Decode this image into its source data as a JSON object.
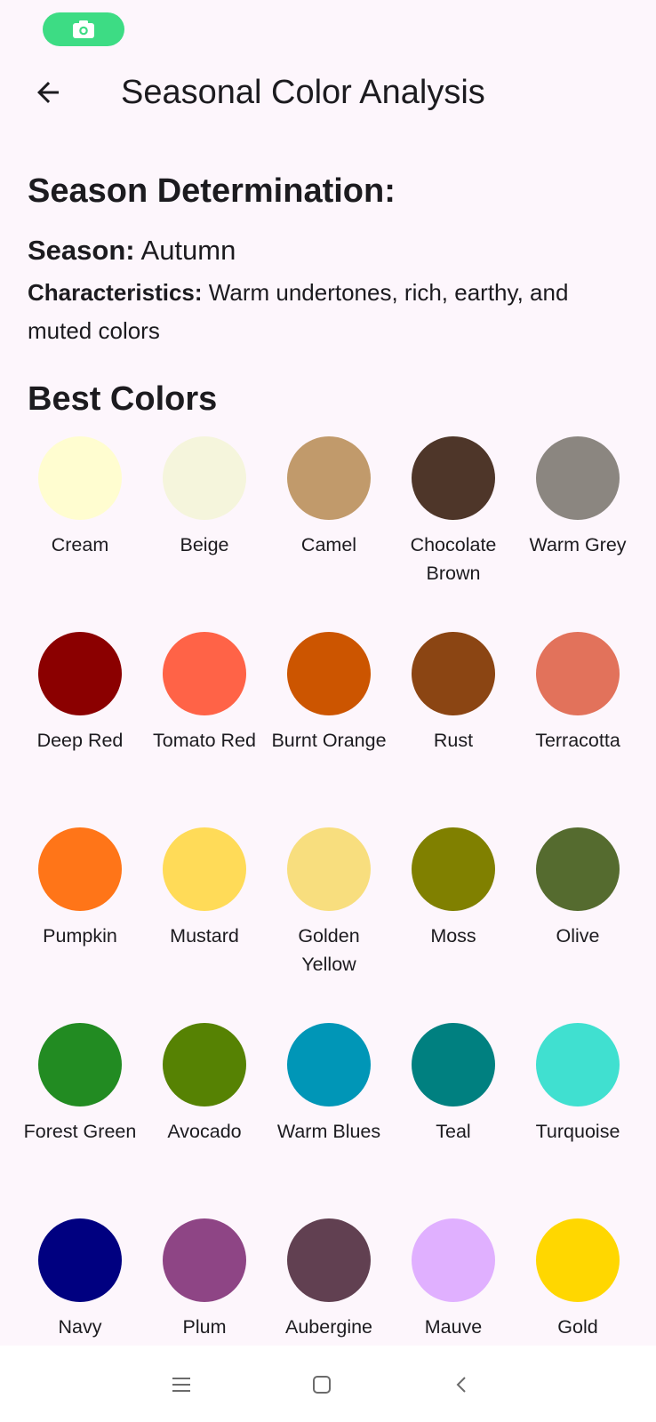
{
  "app_bar": {
    "title": "Seasonal Color Analysis"
  },
  "section": {
    "heading": "Season Determination:",
    "season_label": "Season:",
    "season_value": "Autumn",
    "characteristics_label": "Characteristics:",
    "characteristics_value": "Warm undertones, rich, earthy, and muted colors"
  },
  "best_colors": {
    "heading": "Best Colors",
    "items": [
      {
        "name": "Cream",
        "color": "#FFFDD0"
      },
      {
        "name": "Beige",
        "color": "#F5F5DC"
      },
      {
        "name": "Camel",
        "color": "#C19A6B"
      },
      {
        "name": "Chocolate Brown",
        "color": "#4E3629"
      },
      {
        "name": "Warm Grey",
        "color": "#8B8680"
      },
      {
        "name": "Deep Red",
        "color": "#8B0000"
      },
      {
        "name": "Tomato Red",
        "color": "#FF6347"
      },
      {
        "name": "Burnt Orange",
        "color": "#CC5500"
      },
      {
        "name": "Rust",
        "color": "#8B4513"
      },
      {
        "name": "Terracotta",
        "color": "#E2725B"
      },
      {
        "name": "Pumpkin",
        "color": "#FF7518"
      },
      {
        "name": "Mustard",
        "color": "#FFDB58"
      },
      {
        "name": "Golden Yellow",
        "color": "#F8DE7E"
      },
      {
        "name": "Moss",
        "color": "#808000"
      },
      {
        "name": "Olive",
        "color": "#556B2F"
      },
      {
        "name": "Forest Green",
        "color": "#228B22"
      },
      {
        "name": "Avocado",
        "color": "#568203"
      },
      {
        "name": "Warm Blues",
        "color": "#0096B7"
      },
      {
        "name": "Teal",
        "color": "#008080"
      },
      {
        "name": "Turquoise",
        "color": "#40E0D0"
      },
      {
        "name": "Navy",
        "color": "#000080"
      },
      {
        "name": "Plum",
        "color": "#8E4585"
      },
      {
        "name": "Aubergine",
        "color": "#614051"
      },
      {
        "name": "Mauve",
        "color": "#E0B0FF"
      },
      {
        "name": "Gold",
        "color": "#FFD700"
      }
    ]
  },
  "colors": {
    "background": "#FDF6FC",
    "status_pill": "#3DDC84",
    "text": "#1C1B1F"
  },
  "icons": {
    "back": "arrow-left-icon",
    "status": "camera-icon",
    "nav": [
      "menu-icon",
      "home-icon",
      "back-chevron-icon"
    ]
  }
}
